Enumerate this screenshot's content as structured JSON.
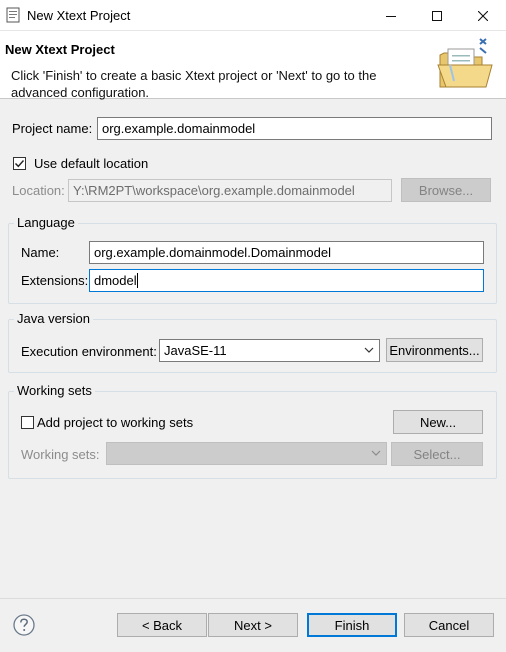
{
  "window": {
    "title": "New Xtext Project",
    "minimize_icon": "minimize-icon",
    "maximize_icon": "maximize-icon",
    "close_icon": "close-icon"
  },
  "banner": {
    "heading": "New Xtext Project",
    "description": "Click 'Finish' to create a basic Xtext project or 'Next' to go to the advanced configuration.",
    "icon": "folder-xtext-icon"
  },
  "project": {
    "name_label": "Project name:",
    "name_value": "org.example.domainmodel",
    "use_default_location_label": "Use default location",
    "use_default_location_checked": true,
    "location_label": "Location:",
    "location_value": "Y:\\RM2PT\\workspace\\org.example.domainmodel",
    "browse_label": "Browse..."
  },
  "language": {
    "group_title": "Language",
    "name_label": "Name:",
    "name_value": "org.example.domainmodel.Domainmodel",
    "extensions_label": "Extensions:",
    "extensions_value": "dmodel"
  },
  "java": {
    "group_title": "Java version",
    "exec_env_label": "Execution environment:",
    "exec_env_value": "JavaSE-11",
    "environments_button": "Environments..."
  },
  "working_sets": {
    "group_title": "Working sets",
    "add_label": "Add project to working sets",
    "add_checked": false,
    "new_button": "New...",
    "sets_label": "Working sets:",
    "sets_value": "",
    "select_button": "Select..."
  },
  "footer": {
    "help_icon": "help-icon",
    "back_button": "< Back",
    "next_button": "Next >",
    "finish_button": "Finish",
    "cancel_button": "Cancel"
  },
  "colors": {
    "focus": "#0078d7",
    "dialog_bg": "#f0f0f0"
  }
}
